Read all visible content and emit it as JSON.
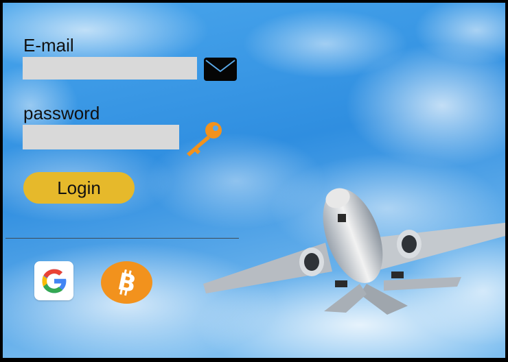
{
  "login_form": {
    "email_label": "E-mail",
    "email_value": "",
    "password_label": "password",
    "password_value": "",
    "login_label": "Login"
  },
  "icons": {
    "email": "envelope-icon",
    "password": "key-icon",
    "google": "google-icon",
    "bitcoin": "bitcoin-icon"
  },
  "colors": {
    "button": "#e6b92b",
    "field": "#d9d9d9",
    "key": "#f2921d",
    "bitcoin": "#f2921d",
    "sky": "#3a9be3"
  }
}
